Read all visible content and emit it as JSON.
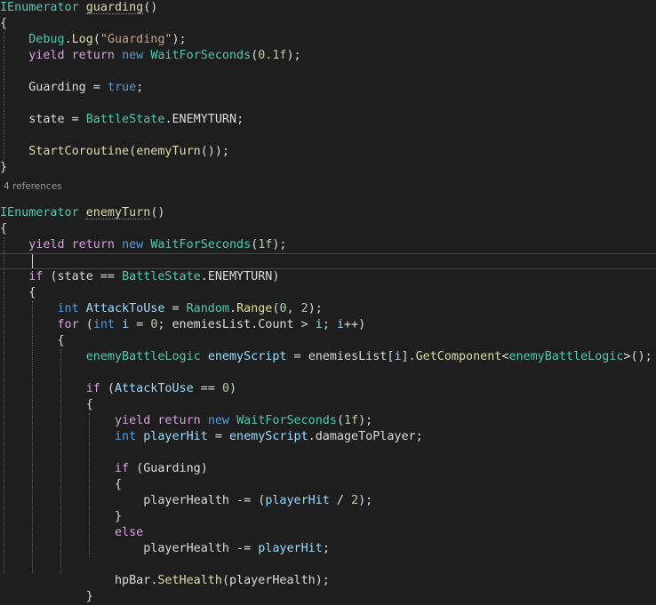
{
  "codelens": "4 references",
  "lines": [
    {
      "current": false,
      "tokens": [
        {
          "t": "IEnumerator",
          "c": "ty"
        },
        {
          "t": " ",
          "c": "pl"
        },
        {
          "t": "guarding",
          "c": "fn ul"
        },
        {
          "t": "()",
          "c": "pl"
        }
      ]
    },
    {
      "current": false,
      "tokens": [
        {
          "t": "{",
          "c": "pl"
        }
      ]
    },
    {
      "current": false,
      "tokens": [
        {
          "t": "    ",
          "c": "pl"
        },
        {
          "t": "Debug",
          "c": "ty"
        },
        {
          "t": ".",
          "c": "pl"
        },
        {
          "t": "Log",
          "c": "fn"
        },
        {
          "t": "(",
          "c": "pl"
        },
        {
          "t": "\"Guarding\"",
          "c": "str"
        },
        {
          "t": ");",
          "c": "pl"
        }
      ]
    },
    {
      "current": false,
      "tokens": [
        {
          "t": "    ",
          "c": "pl"
        },
        {
          "t": "yield",
          "c": "ctl"
        },
        {
          "t": " ",
          "c": "pl"
        },
        {
          "t": "return",
          "c": "ctl"
        },
        {
          "t": " ",
          "c": "pl"
        },
        {
          "t": "new",
          "c": "kw"
        },
        {
          "t": " ",
          "c": "pl"
        },
        {
          "t": "WaitForSeconds",
          "c": "ty"
        },
        {
          "t": "(",
          "c": "pl"
        },
        {
          "t": "0.1f",
          "c": "num"
        },
        {
          "t": ");",
          "c": "pl"
        }
      ]
    },
    {
      "current": false,
      "tokens": []
    },
    {
      "current": false,
      "tokens": [
        {
          "t": "    ",
          "c": "pl"
        },
        {
          "t": "Guarding",
          "c": "field"
        },
        {
          "t": " = ",
          "c": "pl"
        },
        {
          "t": "true",
          "c": "kw"
        },
        {
          "t": ";",
          "c": "pl"
        }
      ]
    },
    {
      "current": false,
      "tokens": []
    },
    {
      "current": false,
      "tokens": [
        {
          "t": "    ",
          "c": "pl"
        },
        {
          "t": "state",
          "c": "field"
        },
        {
          "t": " = ",
          "c": "pl"
        },
        {
          "t": "BattleState",
          "c": "ty"
        },
        {
          "t": ".",
          "c": "pl"
        },
        {
          "t": "ENEMYTURN",
          "c": "field"
        },
        {
          "t": ";",
          "c": "pl"
        }
      ]
    },
    {
      "current": false,
      "tokens": []
    },
    {
      "current": false,
      "tokens": [
        {
          "t": "    ",
          "c": "pl"
        },
        {
          "t": "StartCoroutine",
          "c": "fn"
        },
        {
          "t": "(",
          "c": "pl"
        },
        {
          "t": "enemyTurn",
          "c": "fn"
        },
        {
          "t": "());",
          "c": "pl"
        }
      ]
    },
    {
      "current": false,
      "tokens": [
        {
          "t": "}",
          "c": "pl"
        }
      ]
    },
    {
      "current": false,
      "tokens": []
    },
    {
      "current": false,
      "tokens": [
        {
          "t": "IEnumerator",
          "c": "ty"
        },
        {
          "t": " ",
          "c": "pl"
        },
        {
          "t": "enemyTurn",
          "c": "fn ul"
        },
        {
          "t": "()",
          "c": "pl"
        }
      ]
    },
    {
      "current": false,
      "tokens": [
        {
          "t": "{",
          "c": "pl"
        }
      ]
    },
    {
      "current": false,
      "tokens": [
        {
          "t": "    ",
          "c": "pl"
        },
        {
          "t": "yield",
          "c": "ctl"
        },
        {
          "t": " ",
          "c": "pl"
        },
        {
          "t": "return",
          "c": "ctl"
        },
        {
          "t": " ",
          "c": "pl"
        },
        {
          "t": "new",
          "c": "kw"
        },
        {
          "t": " ",
          "c": "pl"
        },
        {
          "t": "WaitForSeconds",
          "c": "ty"
        },
        {
          "t": "(",
          "c": "pl"
        },
        {
          "t": "1f",
          "c": "num"
        },
        {
          "t": ");",
          "c": "pl"
        }
      ]
    },
    {
      "current": true,
      "tokens": []
    },
    {
      "current": false,
      "tokens": [
        {
          "t": "    ",
          "c": "pl"
        },
        {
          "t": "if",
          "c": "ctl"
        },
        {
          "t": " (",
          "c": "pl"
        },
        {
          "t": "state",
          "c": "field"
        },
        {
          "t": " == ",
          "c": "pl"
        },
        {
          "t": "BattleState",
          "c": "ty"
        },
        {
          "t": ".",
          "c": "pl"
        },
        {
          "t": "ENEMYTURN",
          "c": "field"
        },
        {
          "t": ")",
          "c": "pl"
        }
      ]
    },
    {
      "current": false,
      "tokens": [
        {
          "t": "    {",
          "c": "pl"
        }
      ]
    },
    {
      "current": false,
      "tokens": [
        {
          "t": "        ",
          "c": "pl"
        },
        {
          "t": "int",
          "c": "kw"
        },
        {
          "t": " ",
          "c": "pl"
        },
        {
          "t": "AttackToUse",
          "c": "var"
        },
        {
          "t": " = ",
          "c": "pl"
        },
        {
          "t": "Random",
          "c": "ty"
        },
        {
          "t": ".",
          "c": "pl"
        },
        {
          "t": "Range",
          "c": "fn"
        },
        {
          "t": "(",
          "c": "pl"
        },
        {
          "t": "0",
          "c": "num"
        },
        {
          "t": ", ",
          "c": "pl"
        },
        {
          "t": "2",
          "c": "num"
        },
        {
          "t": ");",
          "c": "pl"
        }
      ]
    },
    {
      "current": false,
      "tokens": [
        {
          "t": "        ",
          "c": "pl"
        },
        {
          "t": "for",
          "c": "ctl"
        },
        {
          "t": " (",
          "c": "pl"
        },
        {
          "t": "int",
          "c": "kw"
        },
        {
          "t": " ",
          "c": "pl"
        },
        {
          "t": "i",
          "c": "var"
        },
        {
          "t": " = ",
          "c": "pl"
        },
        {
          "t": "0",
          "c": "num"
        },
        {
          "t": "; ",
          "c": "pl"
        },
        {
          "t": "enemiesList",
          "c": "field"
        },
        {
          "t": ".",
          "c": "pl"
        },
        {
          "t": "Count",
          "c": "field"
        },
        {
          "t": " > ",
          "c": "pl"
        },
        {
          "t": "i",
          "c": "var"
        },
        {
          "t": "; ",
          "c": "pl"
        },
        {
          "t": "i",
          "c": "var"
        },
        {
          "t": "++)",
          "c": "pl"
        }
      ]
    },
    {
      "current": false,
      "tokens": [
        {
          "t": "        {",
          "c": "pl"
        }
      ]
    },
    {
      "current": false,
      "tokens": [
        {
          "t": "            ",
          "c": "pl"
        },
        {
          "t": "enemyBattleLogic",
          "c": "ty"
        },
        {
          "t": " ",
          "c": "pl"
        },
        {
          "t": "enemyScript",
          "c": "var"
        },
        {
          "t": " = ",
          "c": "pl"
        },
        {
          "t": "enemiesList",
          "c": "field"
        },
        {
          "t": "[",
          "c": "pl"
        },
        {
          "t": "i",
          "c": "var"
        },
        {
          "t": "].",
          "c": "pl"
        },
        {
          "t": "GetComponent",
          "c": "fn"
        },
        {
          "t": "<",
          "c": "pl"
        },
        {
          "t": "enemyBattleLogic",
          "c": "ty"
        },
        {
          "t": ">();",
          "c": "pl"
        }
      ]
    },
    {
      "current": false,
      "tokens": []
    },
    {
      "current": false,
      "tokens": [
        {
          "t": "            ",
          "c": "pl"
        },
        {
          "t": "if",
          "c": "ctl"
        },
        {
          "t": " (",
          "c": "pl"
        },
        {
          "t": "AttackToUse",
          "c": "var"
        },
        {
          "t": " == ",
          "c": "pl"
        },
        {
          "t": "0",
          "c": "num"
        },
        {
          "t": ")",
          "c": "pl"
        }
      ]
    },
    {
      "current": false,
      "tokens": [
        {
          "t": "            {",
          "c": "pl"
        }
      ]
    },
    {
      "current": false,
      "tokens": [
        {
          "t": "                ",
          "c": "pl"
        },
        {
          "t": "yield",
          "c": "ctl"
        },
        {
          "t": " ",
          "c": "pl"
        },
        {
          "t": "return",
          "c": "ctl"
        },
        {
          "t": " ",
          "c": "pl"
        },
        {
          "t": "new",
          "c": "kw"
        },
        {
          "t": " ",
          "c": "pl"
        },
        {
          "t": "WaitForSeconds",
          "c": "ty"
        },
        {
          "t": "(",
          "c": "pl"
        },
        {
          "t": "1f",
          "c": "num"
        },
        {
          "t": ");",
          "c": "pl"
        }
      ]
    },
    {
      "current": false,
      "tokens": [
        {
          "t": "                ",
          "c": "pl"
        },
        {
          "t": "int",
          "c": "kw"
        },
        {
          "t": " ",
          "c": "pl"
        },
        {
          "t": "playerHit",
          "c": "var"
        },
        {
          "t": " = ",
          "c": "pl"
        },
        {
          "t": "enemyScript",
          "c": "var"
        },
        {
          "t": ".",
          "c": "pl"
        },
        {
          "t": "damageToPlayer",
          "c": "field"
        },
        {
          "t": ";",
          "c": "pl"
        }
      ]
    },
    {
      "current": false,
      "tokens": []
    },
    {
      "current": false,
      "tokens": [
        {
          "t": "                ",
          "c": "pl"
        },
        {
          "t": "if",
          "c": "ctl"
        },
        {
          "t": " (",
          "c": "pl"
        },
        {
          "t": "Guarding",
          "c": "field"
        },
        {
          "t": ")",
          "c": "pl"
        }
      ]
    },
    {
      "current": false,
      "tokens": [
        {
          "t": "                {",
          "c": "pl"
        }
      ]
    },
    {
      "current": false,
      "tokens": [
        {
          "t": "                    ",
          "c": "pl"
        },
        {
          "t": "playerHealth",
          "c": "field"
        },
        {
          "t": " -= (",
          "c": "pl"
        },
        {
          "t": "playerHit",
          "c": "var"
        },
        {
          "t": " / ",
          "c": "pl"
        },
        {
          "t": "2",
          "c": "num"
        },
        {
          "t": ");",
          "c": "pl"
        }
      ]
    },
    {
      "current": false,
      "tokens": [
        {
          "t": "                }",
          "c": "pl"
        }
      ]
    },
    {
      "current": false,
      "tokens": [
        {
          "t": "                ",
          "c": "pl"
        },
        {
          "t": "else",
          "c": "ctl"
        }
      ]
    },
    {
      "current": false,
      "tokens": [
        {
          "t": "                    ",
          "c": "pl"
        },
        {
          "t": "playerHealth",
          "c": "field"
        },
        {
          "t": " -= ",
          "c": "pl"
        },
        {
          "t": "playerHit",
          "c": "var"
        },
        {
          "t": ";",
          "c": "pl"
        }
      ]
    },
    {
      "current": false,
      "tokens": []
    },
    {
      "current": false,
      "tokens": [
        {
          "t": "                ",
          "c": "pl"
        },
        {
          "t": "hpBar",
          "c": "field"
        },
        {
          "t": ".",
          "c": "pl"
        },
        {
          "t": "SetHealth",
          "c": "fn"
        },
        {
          "t": "(",
          "c": "pl"
        },
        {
          "t": "playerHealth",
          "c": "field"
        },
        {
          "t": ");",
          "c": "pl"
        }
      ]
    },
    {
      "current": false,
      "tokens": [
        {
          "t": "            }",
          "c": "pl"
        }
      ]
    }
  ]
}
